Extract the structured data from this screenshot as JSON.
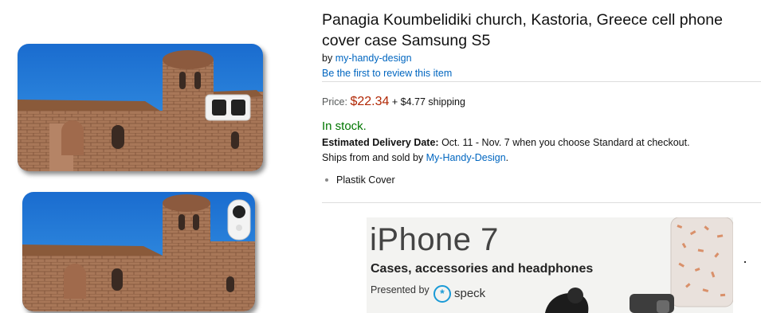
{
  "product": {
    "title": "Panagia Koumbelidiki church, Kastoria, Greece cell phone cover case Samsung S5",
    "by_prefix": "by ",
    "brand": "my-handy-design",
    "review_link": "Be the first to review this item",
    "price_label": "Price:",
    "price": "$22.34",
    "shipping": "+ $4.77 shipping",
    "stock": "In stock.",
    "delivery_label": "Estimated Delivery Date:",
    "delivery_text": " Oct. 11 - Nov. 7 when you choose Standard at checkout.",
    "ships_prefix": "Ships from and sold by ",
    "seller": "My-Handy-Design",
    "ships_suffix": ".",
    "bullets": [
      "Plastik Cover"
    ]
  },
  "ad": {
    "title": "iPhone 7",
    "subtitle": "Cases, accessories and headphones",
    "presented_by": "Presented by",
    "brand": "speck",
    "brand_icon": "asterisk-icon"
  },
  "colors": {
    "link": "#0066c0",
    "price": "#b12704",
    "stock": "#007600",
    "sky": "#1f7fd6",
    "brick": "#9b6b4b"
  }
}
